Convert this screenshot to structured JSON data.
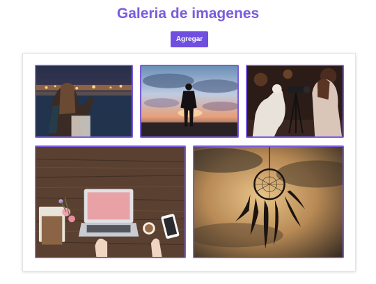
{
  "header": {
    "title": "Galeria de imagenes",
    "add_label": "Agregar"
  },
  "colors": {
    "accent": "#7b5cdb",
    "button": "#6f4ee0"
  },
  "gallery": {
    "images": [
      {
        "name": "woman-photographing-city-lights"
      },
      {
        "name": "man-silhouette-sunset-clouds"
      },
      {
        "name": "woman-with-camera-and-dog"
      },
      {
        "name": "laptop-on-wooden-desk"
      },
      {
        "name": "dreamcatcher-at-sunset"
      }
    ]
  }
}
